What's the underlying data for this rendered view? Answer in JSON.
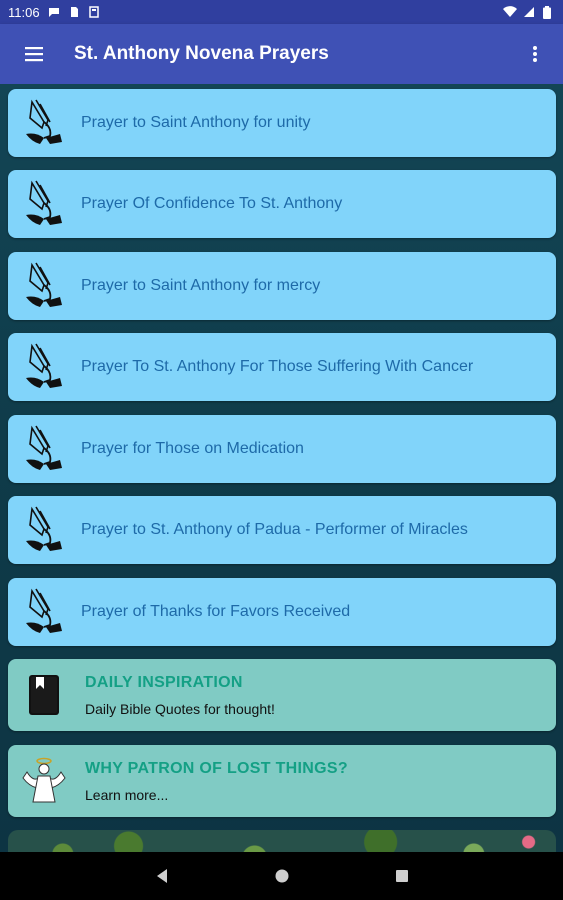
{
  "status_bar": {
    "time": "11:06"
  },
  "app_bar": {
    "title": "St. Anthony Novena Prayers"
  },
  "prayers": [
    {
      "label": "Prayer to Saint Anthony for unity",
      "icon": "praying-hands-icon"
    },
    {
      "label": "Prayer Of Confidence To St. Anthony",
      "icon": "praying-hands-icon"
    },
    {
      "label": "Prayer to Saint Anthony for mercy",
      "icon": "praying-hands-icon"
    },
    {
      "label": "Prayer To St. Anthony For Those Suffering With Cancer",
      "icon": "praying-hands-icon"
    },
    {
      "label": "Prayer for Those on Medication",
      "icon": "praying-hands-icon"
    },
    {
      "label": "Prayer to St. Anthony of Padua - Performer of Miracles",
      "icon": "praying-hands-icon"
    },
    {
      "label": "Prayer of Thanks for Favors Received",
      "icon": "praying-hands-icon"
    }
  ],
  "daily_inspiration": {
    "title": "DAILY INSPIRATION",
    "subtitle": "Daily Bible Quotes for thought!",
    "icon": "bible-book-icon"
  },
  "patron_lost_things": {
    "title": "WHY PATRON OF LOST THINGS?",
    "subtitle": "Learn more...",
    "icon": "angel-icon"
  },
  "colors": {
    "status_bar": "#303f9f",
    "app_bar": "#3f51b5",
    "prayer_card": "#81d4fa",
    "prayer_text": "#1e6aa8",
    "info_card": "#80cbc4",
    "info_title": "#14a085",
    "background": "#0f3a4a"
  }
}
